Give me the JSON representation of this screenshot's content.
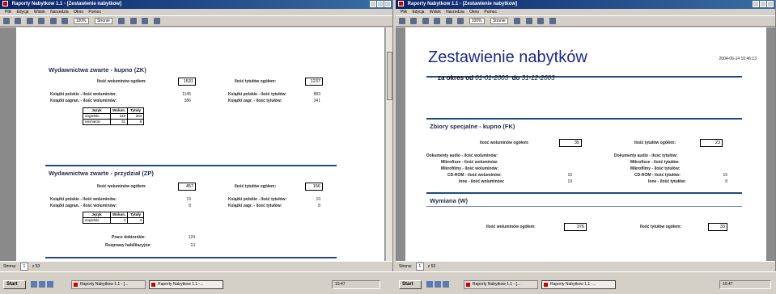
{
  "left_window": {
    "title": "Raporty Nabytkow 1.1 - [Zestawienie nabytkow]",
    "menu": [
      "Plik",
      "Edycja",
      "Widok",
      "Narzedzia",
      "Okno",
      "Pomoc"
    ],
    "zoom": "100%",
    "page_option": "Stronie",
    "section1": {
      "title": "Wydawnictwa zwarte - kupno (ZK)",
      "total_vol_label": "Ilość woluminów ogółem:",
      "total_vol": "1531",
      "total_titles_label": "Ilość tytułów ogółem:",
      "total_titles": "1237",
      "rows": [
        {
          "label_l": "Książki polskie - ilość woluminów:",
          "val_l": "1145",
          "label_r": "Książki polskie - ilość tytułów:",
          "val_r": "883"
        },
        {
          "label_l": "Książki zagran. - ilość woluminów:",
          "val_l": "386",
          "label_r": "Książki zagr. - ilość tytułów:",
          "val_r": "341"
        }
      ],
      "table_headers": [
        "Język",
        "Wolum.",
        "Tytuły"
      ],
      "table_rows": [
        [
          "angielski",
          "348",
          "304"
        ],
        [
          "niemiecki",
          "31",
          "8"
        ]
      ]
    },
    "section2": {
      "title": "Wydawnictwa zwarte - przydział (ZP)",
      "total_vol_label": "Ilość woluminów ogółem:",
      "total_vol": "457",
      "total_titles_label": "Ilość tytułów ogółem:",
      "total_titles": "156",
      "rows": [
        {
          "label_l": "Książki polskie - ilość woluminów:",
          "val_l": "13",
          "label_r": "Książki polskie - ilość tytułów:",
          "val_r": "10"
        },
        {
          "label_l": "Książki zagran. - ilość woluminów:",
          "val_l": "8",
          "label_r": "Książki zagr. - ilość tytułów:",
          "val_r": "8"
        }
      ],
      "table_headers": [
        "Język",
        "Wolum.",
        "Tytuły"
      ],
      "table_rows": [
        [
          "angielski",
          "3",
          "3"
        ]
      ],
      "extra": [
        {
          "label": "Prace doktorskie:",
          "val": "124"
        },
        {
          "label": "Rozprawy habilitacyjne:",
          "val": "13"
        }
      ]
    },
    "status": {
      "page_label": "Strona:",
      "page_num": "1",
      "of": "z 53"
    }
  },
  "right_window": {
    "title": "Raporty Nabytkow 1.1 - [Zestawienie nabytkow]",
    "menu": [
      "Plik",
      "Edycja",
      "Widok",
      "Narzedzia",
      "Okno",
      "Pomoc"
    ],
    "zoom": "100%",
    "page_option": "Stronie",
    "report_title": "Zestawienie nabytków",
    "date_stamp": "2004-06-14 10:46:13",
    "period_from_label": "za okres od",
    "period_from": "01-01-2003",
    "period_to_label": "do",
    "period_to": "31-12-2003",
    "section1": {
      "title": "Zbiory specjalne - kupno (FK)",
      "total_vol_label": "Ilość woluminów ogółem:",
      "total_vol": "35",
      "total_titles_label": "Ilość tytułów ogółem:",
      "total_titles": "23",
      "rows": [
        {
          "label_l": "Dokumenty audio - ilość woluminów:",
          "val_l": "",
          "label_r": "Dokumenty audio - ilość tytułów:",
          "val_r": ""
        },
        {
          "label_l": "Mikrofisze - ilość woluminów:",
          "val_l": "",
          "label_r": "Mikrofisze - ilość tytułów:",
          "val_r": ""
        },
        {
          "label_l": "Mikrofilmy - ilość woluminów:",
          "val_l": "",
          "label_r": "Mikrofilmy - ilość tytułów:",
          "val_r": ""
        },
        {
          "label_l": "CD-ROM - ilość woluminów:",
          "val_l": "16",
          "label_r": "CD-ROM - ilość tytułów:",
          "val_r": "15"
        },
        {
          "label_l": "Inne - ilość woluminów:",
          "val_l": "19",
          "label_r": "Inne - ilość tytułów:",
          "val_r": "8"
        }
      ]
    },
    "section2": {
      "title": "Wymiana (W)",
      "total_vol_label": "Ilość woluminów ogółem:",
      "total_vol": "376",
      "total_titles_label": "Ilość tytułów ogółem:",
      "total_titles": "33"
    },
    "status": {
      "page_label": "Strona:",
      "page_num": "1",
      "of": "z 53"
    }
  },
  "taskbar": {
    "start": "Start",
    "left_items": [
      "Raporty Nabytkow 1.1 - [...",
      "Raporty Nabytkow 1.1 -..."
    ],
    "right_items": [
      "Raporty Nabytkow 1.1 - [...",
      "Raporty Nabytkow 1.1 -..."
    ],
    "clock_left": "10:47",
    "clock_right": "10:47"
  },
  "colors": {
    "accent": "#1a4a8a",
    "title_blue": "#1a2a8a",
    "titlebar": "#0a246a"
  }
}
